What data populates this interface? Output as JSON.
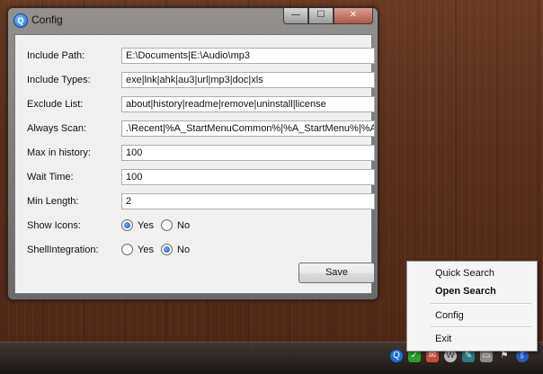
{
  "window": {
    "title": "Config",
    "minimize_glyph": "—",
    "maximize_glyph": "☐",
    "close_glyph": "✕"
  },
  "form": {
    "include_path": {
      "label": "Include Path:",
      "value": "E:\\Documents|E:\\Audio\\mp3"
    },
    "include_types": {
      "label": "Include Types:",
      "value": "exe|lnk|ahk|au3|url|mp3|doc|xls"
    },
    "exclude_list": {
      "label": "Exclude List:",
      "value": "about|history|readme|remove|uninstall|license"
    },
    "always_scan": {
      "label": "Always Scan:",
      "value": ".\\Recent|%A_StartMenuCommon%|%A_StartMenu%|%A_Desktop%"
    },
    "max_in_history": {
      "label": "Max in history:",
      "value": "100"
    },
    "wait_time": {
      "label": "Wait Time:",
      "value": "100"
    },
    "min_length": {
      "label": "Min Length:",
      "value": "2"
    },
    "show_icons": {
      "label": "Show Icons:",
      "yes": "Yes",
      "no": "No",
      "selected": "Yes"
    },
    "shell_integration": {
      "label": "ShellIntegration:",
      "yes": "Yes",
      "no": "No",
      "selected": "No"
    },
    "save_label": "Save"
  },
  "context_menu": {
    "items": [
      {
        "label": "Quick Search",
        "bold": false
      },
      {
        "label": "Open Search",
        "bold": true
      },
      {
        "label": "Config",
        "bold": false
      },
      {
        "label": "Exit",
        "bold": false
      }
    ]
  },
  "tray": {
    "icons": [
      "search-icon",
      "check-icon",
      "mail-icon",
      "wordpress-icon",
      "paint-icon",
      "monitor-icon",
      "flag-icon",
      "bluetooth-icon"
    ]
  },
  "colors": {
    "accent": "#1d6fd0",
    "desktop": "#5b2f1b"
  }
}
